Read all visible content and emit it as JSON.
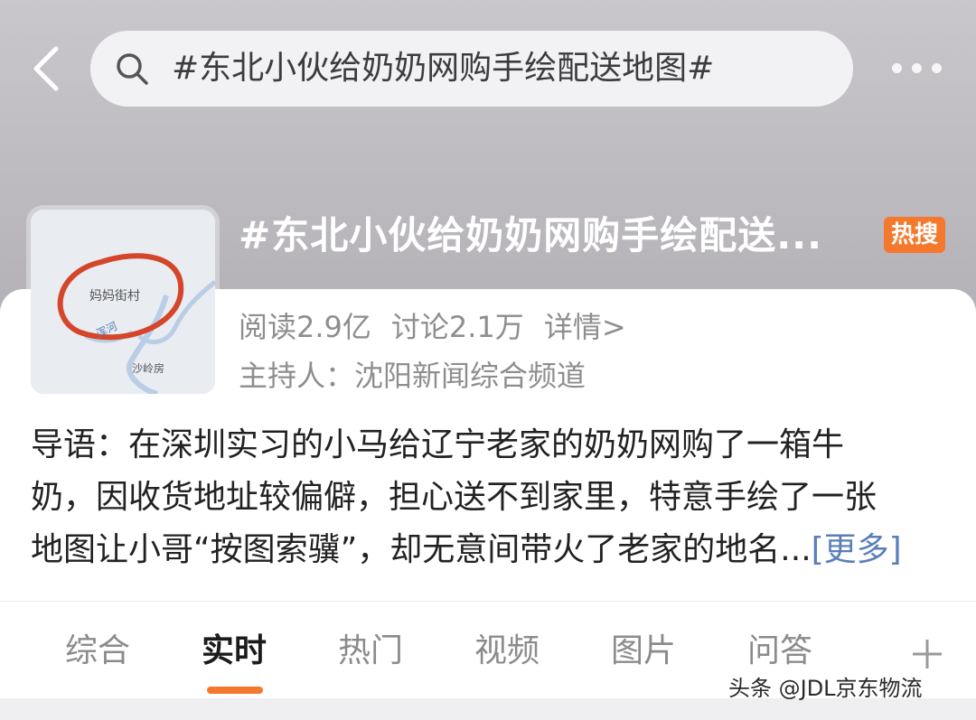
{
  "search": {
    "query": "#东北小伙给奶奶网购手绘配送地图#"
  },
  "topic": {
    "title": "#东北小伙给奶奶网购手绘配送...",
    "badge": "热搜",
    "badge_color": "#f5792c",
    "reads": "阅读2.9亿",
    "discussions": "讨论2.1万",
    "details_link": "详情>",
    "host": "主持人：沈阳新闻综合频道",
    "thumbnail": {
      "labels": [
        "妈妈街村",
        "浑河",
        "沙岭房"
      ]
    }
  },
  "intro": {
    "lines": [
      "导语：在深圳实习的小马给辽宁老家的奶奶网购了一箱牛",
      "奶，因收货地址较偏僻，担心送不到家里，特意手绘了一张",
      "地图让小哥“按图索骥”，却无意间带火了老家的地名..."
    ],
    "more": "[更多]"
  },
  "tabs": {
    "items": [
      {
        "label": "综合"
      },
      {
        "label": "实时"
      },
      {
        "label": "热门"
      },
      {
        "label": "视频"
      },
      {
        "label": "图片"
      },
      {
        "label": "问答"
      }
    ],
    "active": "实时",
    "accent": "#f5792c"
  },
  "watermark": "头条 @JDL京东物流",
  "icons": [
    "back-icon",
    "search-icon",
    "more-icon",
    "plus-icon"
  ]
}
